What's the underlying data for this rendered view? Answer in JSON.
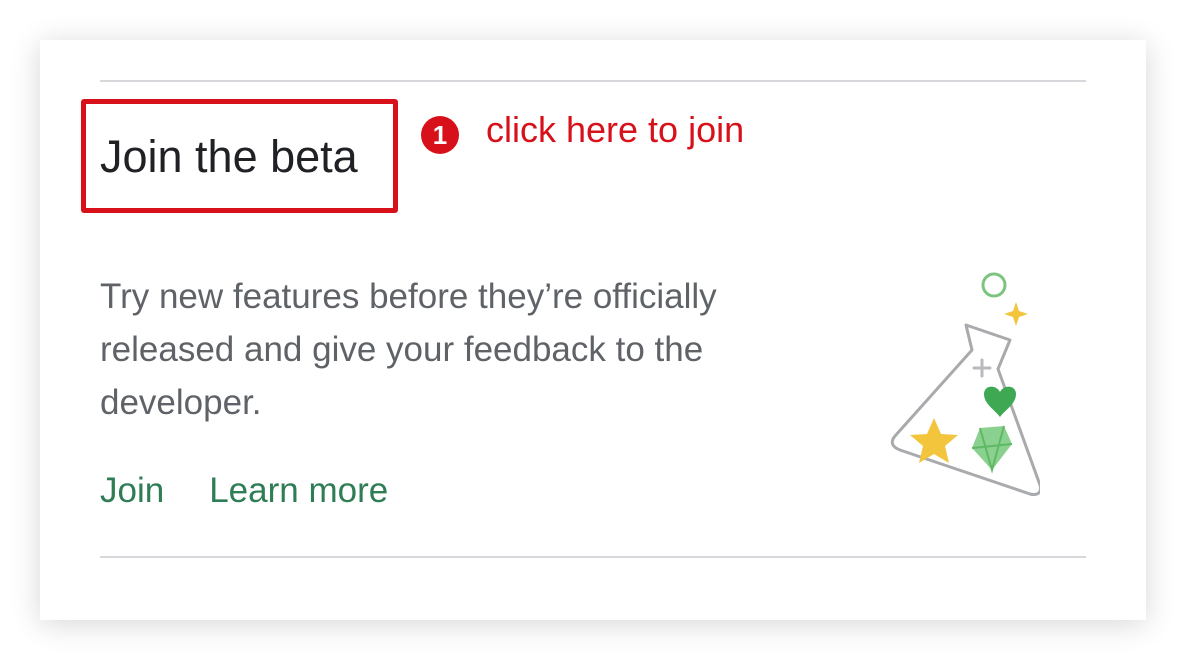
{
  "beta_card": {
    "title": "Join the beta",
    "description": "Try new features before they’re officially released and give your feedback to the developer.",
    "actions": {
      "join_label": "Join",
      "learn_more_label": "Learn more"
    },
    "illustration": "beta-flask-icon"
  },
  "annotation": {
    "number": "1",
    "text": "click here to join"
  },
  "colors": {
    "annotation_red": "#d7101a",
    "link_green": "#2e7d55",
    "title_text": "#202124",
    "body_text": "#5f6368",
    "divider": "#d8d8dc"
  }
}
